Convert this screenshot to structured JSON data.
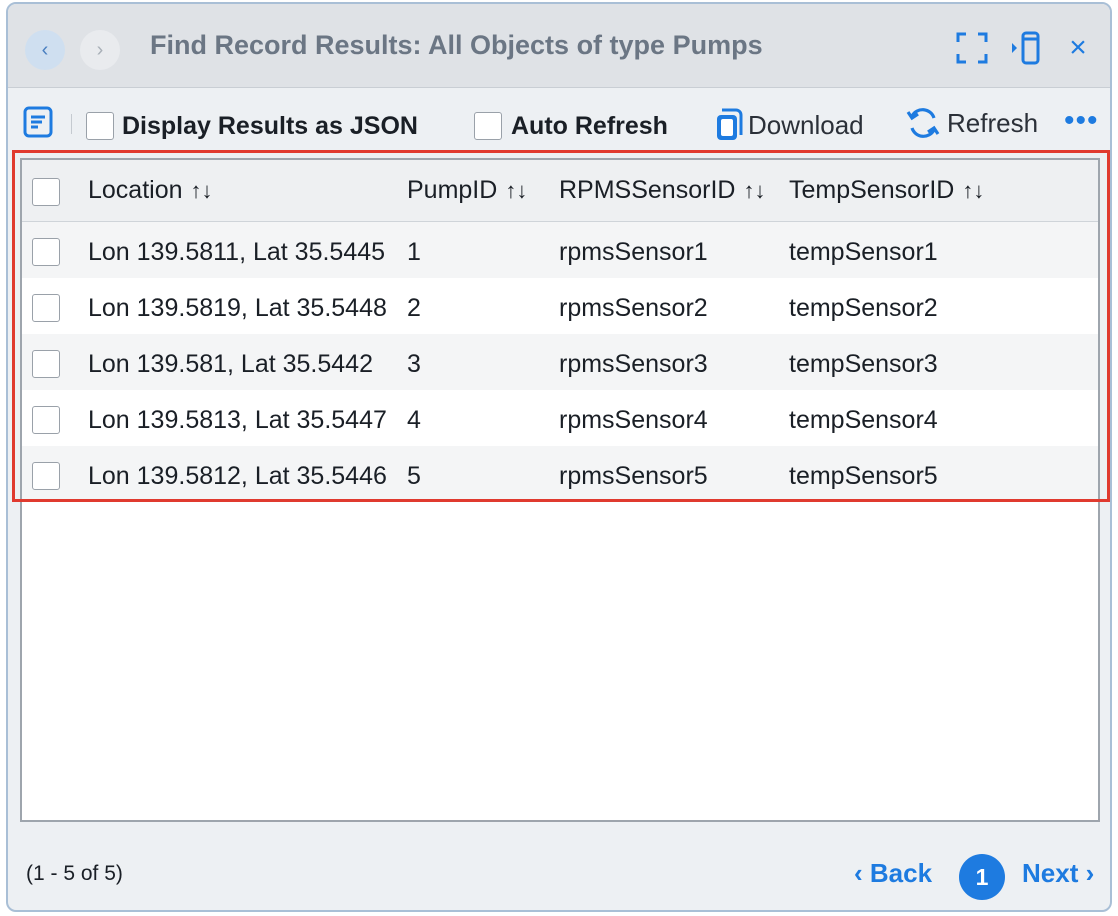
{
  "window": {
    "title": "Find Record Results: All Objects of type Pumps",
    "back_icon": "‹",
    "forward_icon": "›",
    "close_icon": "×"
  },
  "toolbar": {
    "json_label": "Display Results as JSON",
    "auto_refresh_label": "Auto Refresh",
    "download_label": "Download",
    "refresh_label": "Refresh",
    "more_label": "•••"
  },
  "table": {
    "sort_glyph": "↑↓",
    "columns": [
      "Location",
      "PumpID",
      "RPMSSensorID",
      "TempSensorID"
    ],
    "rows": [
      [
        "Lon 139.5811, Lat 35.5445",
        "1",
        "rpmsSensor1",
        "tempSensor1"
      ],
      [
        "Lon 139.5819, Lat 35.5448",
        "2",
        "rpmsSensor2",
        "tempSensor2"
      ],
      [
        "Lon 139.581, Lat 35.5442",
        "3",
        "rpmsSensor3",
        "tempSensor3"
      ],
      [
        "Lon 139.5813, Lat 35.5447",
        "4",
        "rpmsSensor4",
        "tempSensor4"
      ],
      [
        "Lon 139.5812, Lat 35.5446",
        "5",
        "rpmsSensor5",
        "tempSensor5"
      ]
    ]
  },
  "footer": {
    "count_text": "(1 - 5 of 5)",
    "back_label": "‹ Back",
    "current_page": "1",
    "next_label": "Next ›"
  },
  "colors": {
    "accent": "#1e7be0",
    "highlight_border": "#e03a2f"
  }
}
